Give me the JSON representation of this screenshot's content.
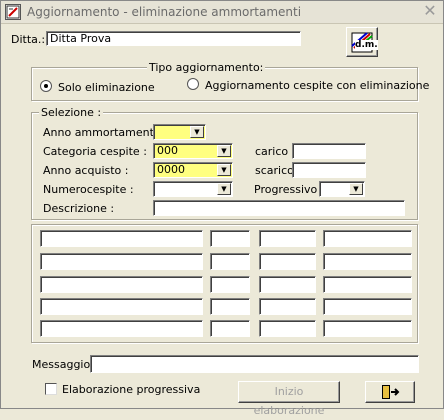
{
  "window": {
    "title": "Aggiornamento - eliminazione ammortamenti",
    "close_glyph": "✕"
  },
  "ditta": {
    "label": "Ditta.:",
    "value": "Ditta Prova",
    "logo_text": "d.m."
  },
  "tipo": {
    "title": "Tipo aggiornamento:",
    "options": [
      "Solo eliminazione",
      "Aggiornamento cespite con eliminazione"
    ],
    "selected": 0
  },
  "selezione": {
    "title": "Selezione :",
    "anno_ammortamenti": {
      "label": "Anno ammortamenti  :",
      "value": ""
    },
    "categoria": {
      "label": "Categoria cespite :",
      "value": "000"
    },
    "anno_acquisto": {
      "label": "Anno acquisto :",
      "value": "0000"
    },
    "numerocespite": {
      "label": "Numerocespite :",
      "value": ""
    },
    "progressivo": {
      "label": "Progressivo :",
      "value": ""
    },
    "descrizione": {
      "label": "Descrizione :",
      "value": ""
    },
    "carico": {
      "label": "carico",
      "value": ""
    },
    "scarico": {
      "label": "scarico",
      "value": ""
    }
  },
  "messaggio": {
    "label": "Messaggio:",
    "value": ""
  },
  "elaborazione_progressiva": {
    "label": "Elaborazione progressiva",
    "checked": false
  },
  "buttons": {
    "inizio": "Inizio elaborazione",
    "exit_icon": "exit-door-icon"
  }
}
